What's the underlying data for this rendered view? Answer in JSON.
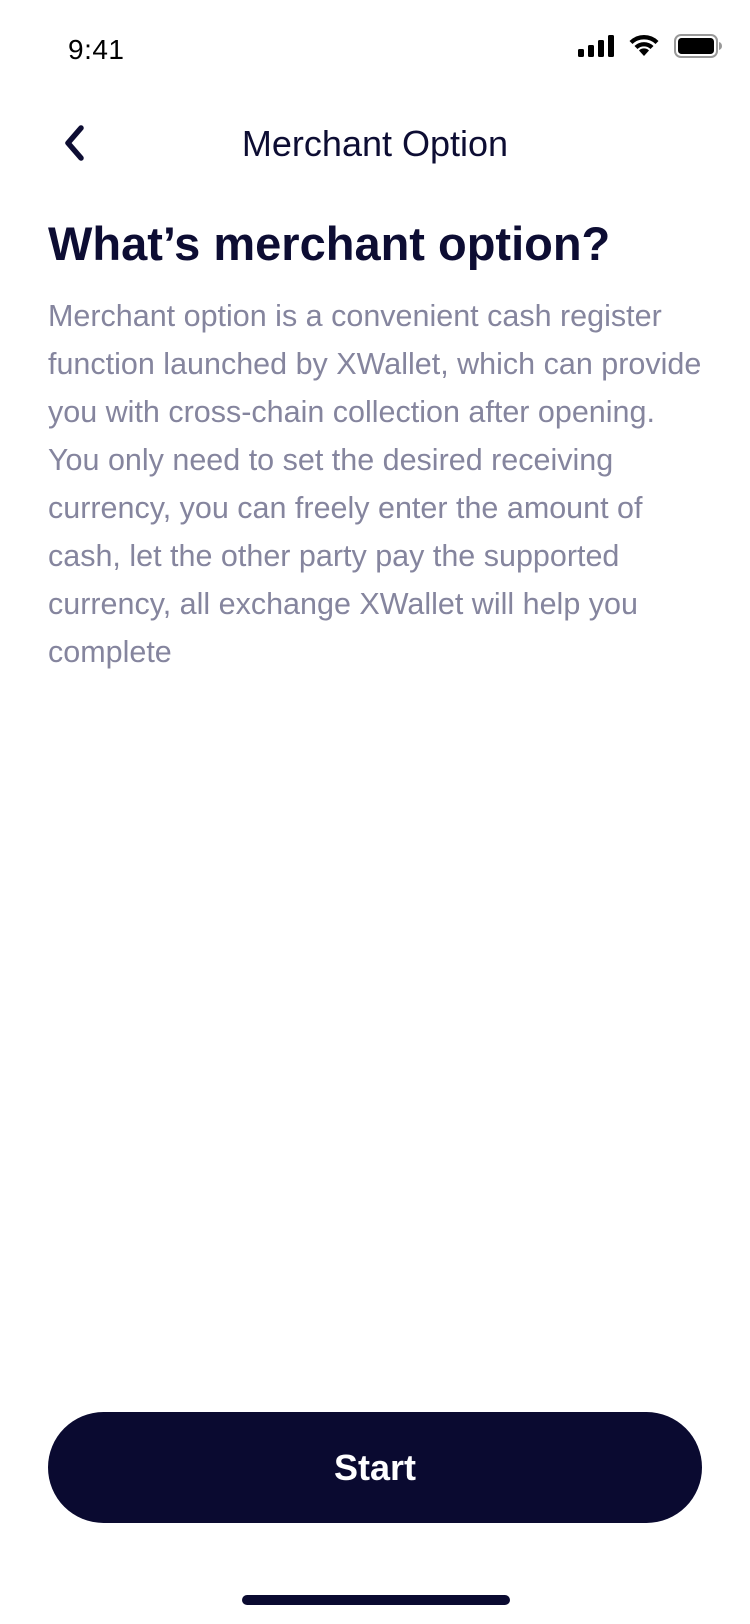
{
  "status_bar": {
    "time": "9:41",
    "icons": [
      "cellular-signal-icon",
      "wifi-icon",
      "battery-icon"
    ]
  },
  "nav": {
    "title": "Merchant Option",
    "back_icon": "chevron-left-icon"
  },
  "content": {
    "heading": "What’s merchant option?",
    "description": "Merchant option is a convenient cash register function launched by XWallet, which can provide you with cross-chain collection after opening. You only need to set the desired receiving currency, you can freely enter the amount of cash, let the other party pay the supported currency, all exchange XWallet will help you complete"
  },
  "actions": {
    "start_label": "Start"
  },
  "colors": {
    "primary": "#0a0a30",
    "body_text": "#85859e",
    "background": "#ffffff"
  }
}
